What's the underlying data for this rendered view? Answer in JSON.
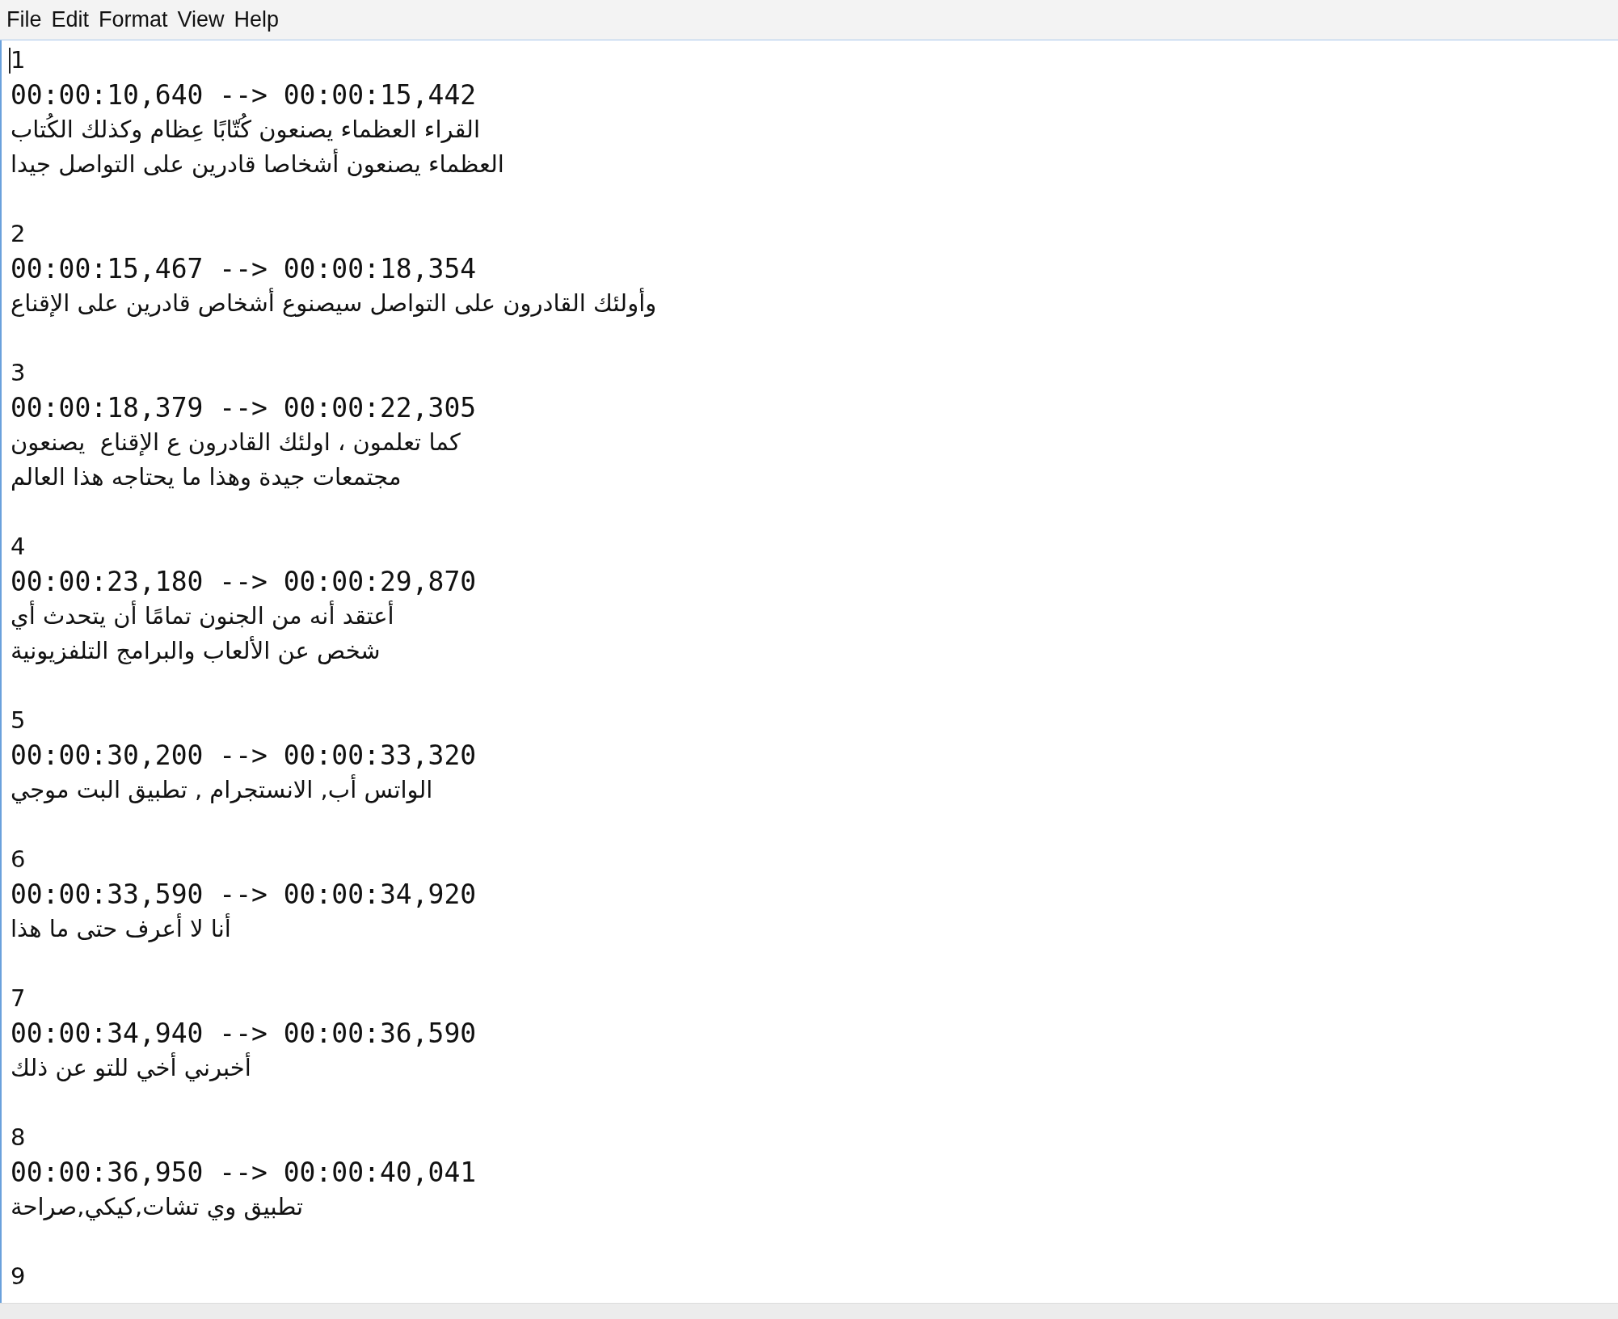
{
  "menu": {
    "file": "File",
    "edit": "Edit",
    "format": "Format",
    "view": "View",
    "help": "Help"
  },
  "cues": [
    {
      "index": "1",
      "timing": "00:00:10,640 --> 00:00:15,442",
      "lines": [
        "القراء العظماء يصنعون كُتّابًا عِظام وكذلك الكُتاب",
        "العظماء يصنعون أشخاصا قادرين على التواصل جيدا"
      ]
    },
    {
      "index": "2",
      "timing": "00:00:15,467 --> 00:00:18,354",
      "lines": [
        "وأولئك القادرون على التواصل سيصنوع أشخاص قادرين على الإقناع"
      ]
    },
    {
      "index": "3",
      "timing": "00:00:18,379 --> 00:00:22,305",
      "lines": [
        "كما تعلمون ، اولئك القادرون ع الإقناع  يصنعون",
        "مجتمعات جيدة وهذا ما يحتاجه هذا العالم"
      ]
    },
    {
      "index": "4",
      "timing": "00:00:23,180 --> 00:00:29,870",
      "lines": [
        "أعتقد أنه من الجنون تمامًا أن يتحدث أي",
        "شخص عن الألعاب والبرامج التلفزيونية"
      ]
    },
    {
      "index": "5",
      "timing": "00:00:30,200 --> 00:00:33,320",
      "lines": [
        "الواتس أب, الانستجرام , تطبيق البت موجي"
      ]
    },
    {
      "index": "6",
      "timing": "00:00:33,590 --> 00:00:34,920",
      "lines": [
        "أنا لا أعرف حتى ما هذا"
      ]
    },
    {
      "index": "7",
      "timing": "00:00:34,940 --> 00:00:36,590",
      "lines": [
        "أخبرني أخي للتو عن ذلك"
      ]
    },
    {
      "index": "8",
      "timing": "00:00:36,950 --> 00:00:40,041",
      "lines": [
        "تطبيق وي تشات,كيكي,صراحة"
      ]
    },
    {
      "index": "9"
    }
  ]
}
